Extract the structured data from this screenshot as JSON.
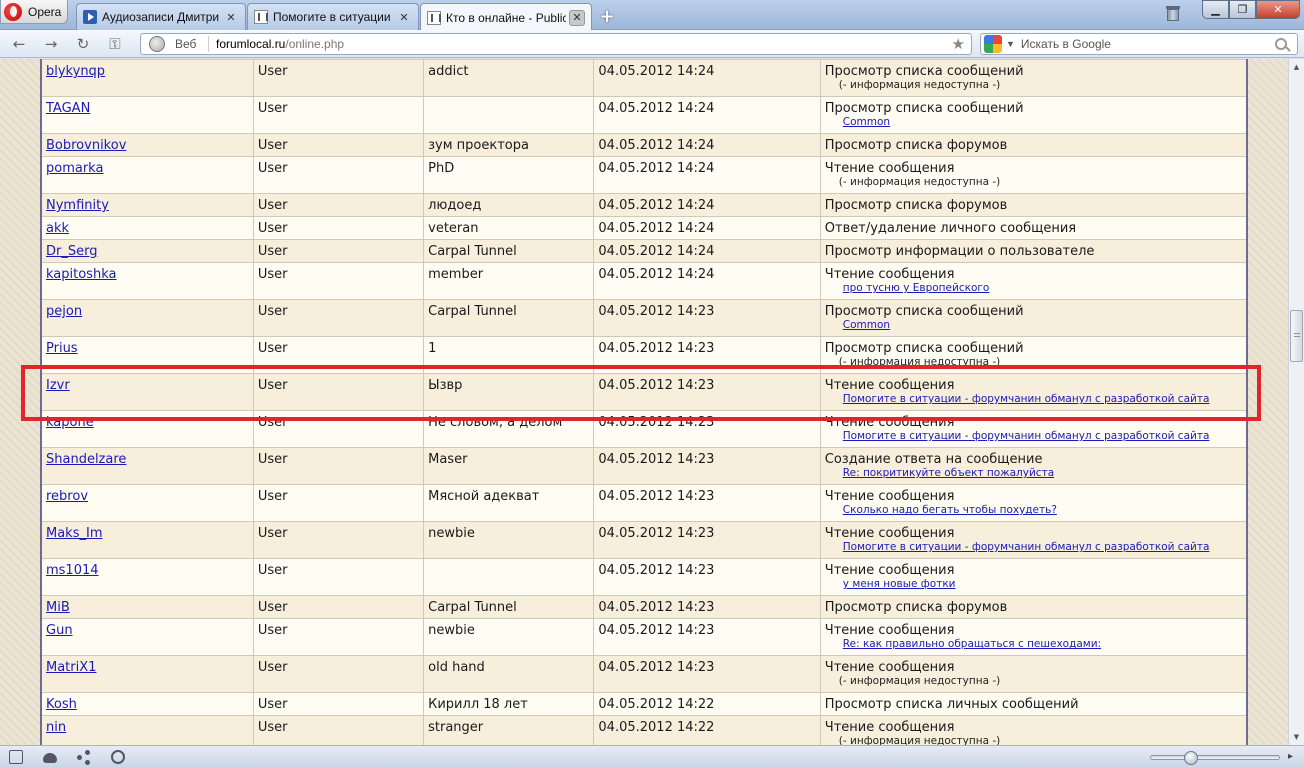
{
  "browser": {
    "menu_label": "Opera",
    "tabs": [
      {
        "title": "Аудиозаписи Дмитри...",
        "icon": "play-icon",
        "active": false
      },
      {
        "title": "Помогите в ситуации ...",
        "icon": "forum-icon",
        "active": false
      },
      {
        "title": "Кто в онлайне - Public...",
        "icon": "forum-icon",
        "active": true
      }
    ],
    "tab_close_glyph": "✕",
    "new_tab_glyph": "+",
    "window_controls": {
      "minimize": "▁",
      "restore": "❐",
      "close": "✕"
    }
  },
  "address_bar": {
    "web_label": "Веб",
    "url_host": "forumlocal.ru",
    "url_path": "/online.php",
    "bookmark_glyph": "★"
  },
  "search_bar": {
    "placeholder": "Искать в Google",
    "caret_glyph": "▼"
  },
  "nav": {
    "back": "←",
    "forward": "→",
    "reload": "↻",
    "key": "⚿"
  },
  "online_table": {
    "rows": [
      {
        "username": "blykynqp",
        "role": "User",
        "title": "addict",
        "time": "04.05.2012 14:24",
        "action": "Просмотр списка сообщений",
        "note": "(- информация недоступна -)"
      },
      {
        "username": "TAGAN",
        "role": "User",
        "title": "",
        "time": "04.05.2012 14:24",
        "action": "Просмотр списка сообщений",
        "link": "Common"
      },
      {
        "username": "Bobrovnikov",
        "role": "User",
        "title": "зум проектора",
        "time": "04.05.2012 14:24",
        "action": "Просмотр списка форумов"
      },
      {
        "username": "pomarka",
        "role": "User",
        "title": "PhD",
        "time": "04.05.2012 14:24",
        "action": "Чтение сообщения",
        "note": "(- информация недоступна -)"
      },
      {
        "username": "Nymfinity",
        "role": "User",
        "title": "людоед",
        "time": "04.05.2012 14:24",
        "action": "Просмотр списка форумов"
      },
      {
        "username": "akk",
        "role": "User",
        "title": "veteran",
        "time": "04.05.2012 14:24",
        "action": "Ответ/удаление личного сообщения"
      },
      {
        "username": "Dr_Serg",
        "role": "User",
        "title": "Carpal Tunnel",
        "time": "04.05.2012 14:24",
        "action": "Просмотр информации о пользователе"
      },
      {
        "username": "kapitoshka",
        "role": "User",
        "title": "member",
        "time": "04.05.2012 14:24",
        "action": "Чтение сообщения",
        "link": "про тусню у Европейского"
      },
      {
        "username": "pejon",
        "role": "User",
        "title": "Carpal Tunnel",
        "time": "04.05.2012 14:23",
        "action": "Просмотр списка сообщений",
        "link": "Common"
      },
      {
        "username": "Prius",
        "role": "User",
        "title": "1",
        "time": "04.05.2012 14:23",
        "action": "Просмотр списка сообщений",
        "note": "(- информация недоступна -)"
      },
      {
        "username": "Izvr",
        "role": "User",
        "title": "Ызвр",
        "time": "04.05.2012 14:23",
        "action": "Чтение сообщения",
        "link": "Помогите в ситуации - форумчанин обманул с разработкой сайта"
      },
      {
        "username": "kapone",
        "role": "User",
        "title": "Не словом, а делом",
        "time": "04.05.2012 14:23",
        "action": "Чтение сообщения",
        "link": "Помогите в ситуации - форумчанин обманул с разработкой сайта"
      },
      {
        "username": "Shandelzare",
        "role": "User",
        "title": "Maser",
        "time": "04.05.2012 14:23",
        "action": "Создание ответа на сообщение",
        "link": "Re: покритикуйте объект пожалуйста"
      },
      {
        "username": "rebrov",
        "role": "User",
        "title": "Мясной адекват",
        "time": "04.05.2012 14:23",
        "action": "Чтение сообщения",
        "link": "Сколько надо бегать чтобы похудеть?"
      },
      {
        "username": "Maks_Im",
        "role": "User",
        "title": "newbie",
        "time": "04.05.2012 14:23",
        "action": "Чтение сообщения",
        "link": "Помогите в ситуации - форумчанин обманул с разработкой сайта"
      },
      {
        "username": "ms1014",
        "role": "User",
        "title": "",
        "time": "04.05.2012 14:23",
        "action": "Чтение сообщения",
        "link": "у меня новые фотки"
      },
      {
        "username": "MiB",
        "role": "User",
        "title": "Carpal Tunnel",
        "time": "04.05.2012 14:23",
        "action": "Просмотр списка форумов"
      },
      {
        "username": "Gun",
        "role": "User",
        "title": "newbie",
        "time": "04.05.2012 14:23",
        "action": "Чтение сообщения",
        "link": "Re: как правильно обращаться с пешеходами:"
      },
      {
        "username": "MatriX1",
        "role": "User",
        "title": "old hand",
        "time": "04.05.2012 14:23",
        "action": "Чтение сообщения",
        "note": "(- информация недоступна -)"
      },
      {
        "username": "Kosh",
        "role": "User",
        "title": "Кирилл 18 лет",
        "time": "04.05.2012 14:22",
        "action": "Просмотр списка личных сообщений"
      },
      {
        "username": "nin",
        "role": "User",
        "title": "stranger",
        "time": "04.05.2012 14:22",
        "action": "Чтение сообщения",
        "note": "(- информация недоступна -)"
      }
    ],
    "highlighted_row": 10
  },
  "colors": {
    "link": "#1a1ab8",
    "row_a": "#fffdf3",
    "row_b": "#f7efdc",
    "highlight": "#e0262b"
  }
}
